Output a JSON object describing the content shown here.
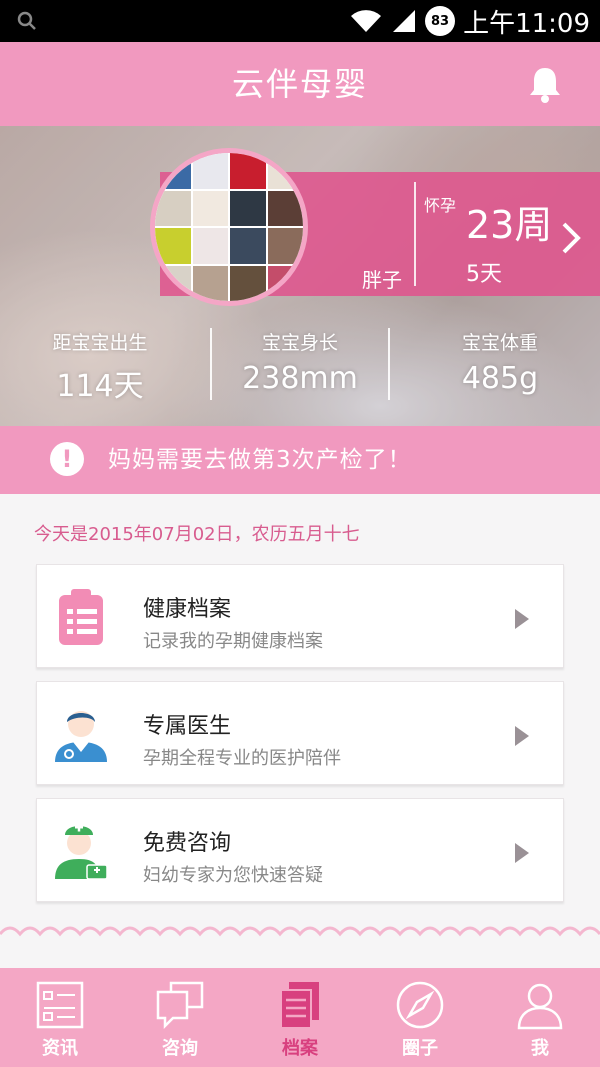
{
  "status_bar": {
    "time": "上午11:09",
    "battery": "83"
  },
  "header": {
    "title": "云伴母婴"
  },
  "profile": {
    "nickname": "胖子",
    "pregnancy_label": "怀孕",
    "weeks": "23周",
    "days": "5天",
    "stats": [
      {
        "label": "距宝宝出生",
        "value": "114天"
      },
      {
        "label": "宝宝身长",
        "value": "238mm"
      },
      {
        "label": "宝宝体重",
        "value": "485g"
      }
    ]
  },
  "notice": {
    "text": "妈妈需要去做第3次产检了！"
  },
  "date_line": "今天是2015年07月02日，农历五月十七",
  "cards": [
    {
      "title": "健康档案",
      "subtitle": "记录我的孕期健康档案",
      "icon": "clipboard-icon"
    },
    {
      "title": "专属医生",
      "subtitle": "孕期全程专业的医护陪伴",
      "icon": "doctor-icon"
    },
    {
      "title": "免费咨询",
      "subtitle": "妇幼专家为您快速答疑",
      "icon": "nurse-icon"
    }
  ],
  "tabs": [
    {
      "label": "资讯",
      "icon": "news-icon",
      "active": false
    },
    {
      "label": "咨询",
      "icon": "chat-icon",
      "active": false
    },
    {
      "label": "档案",
      "icon": "records-icon",
      "active": true
    },
    {
      "label": "圈子",
      "icon": "compass-icon",
      "active": false
    },
    {
      "label": "我",
      "icon": "person-icon",
      "active": false
    }
  ],
  "colors": {
    "primary_pink": "#f199bf",
    "band_pink": "#df548d",
    "date_text": "#d85c8f",
    "tab_active": "#d8407f"
  }
}
